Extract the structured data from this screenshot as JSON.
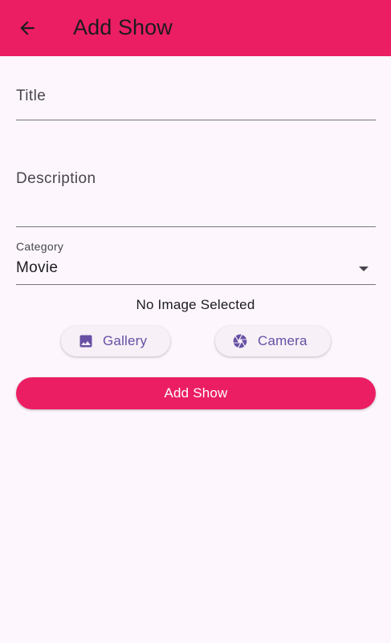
{
  "appbar": {
    "title": "Add Show",
    "back_icon": "arrow-left-icon",
    "color": "#ec1e63"
  },
  "form": {
    "title_label": "Title",
    "description_label": "Description",
    "category_label": "Category",
    "category_value": "Movie"
  },
  "image": {
    "status_text": "No Image Selected",
    "gallery_label": "Gallery",
    "gallery_icon": "image-icon",
    "camera_label": "Camera",
    "camera_icon": "camera-aperture-icon"
  },
  "submit": {
    "label": "Add Show"
  },
  "colors": {
    "accent": "#ec1e63",
    "secondary": "#6750a4",
    "background": "#fdf7fd"
  }
}
